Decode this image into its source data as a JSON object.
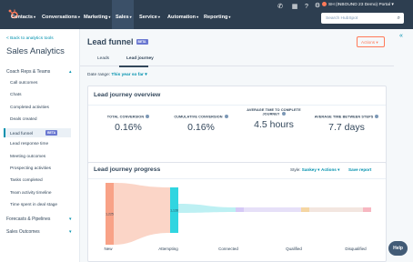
{
  "topnav": {
    "items": [
      {
        "label": "Contacts"
      },
      {
        "label": "Conversations"
      },
      {
        "label": "Marketing"
      },
      {
        "label": "Sales"
      },
      {
        "label": "Service"
      },
      {
        "label": "Automation"
      },
      {
        "label": "Reporting"
      }
    ],
    "account": "SH (INBOUND 23 Demo) Portal",
    "search_placeholder": "Search HubSpot",
    "icons": [
      "phone-icon",
      "marketplace-icon",
      "help-icon",
      "settings-icon",
      "bell-icon"
    ]
  },
  "sidebar": {
    "back_link": "< Back to analytics tools",
    "title": "Sales Analytics",
    "sections": [
      {
        "label": "Coach Reps & Teams",
        "expanded": true
      },
      {
        "label": "Forecasts & Pipelines",
        "expanded": false
      },
      {
        "label": "Sales Outcomes",
        "expanded": false
      }
    ],
    "items": [
      {
        "label": "Call outcomes"
      },
      {
        "label": "Chats"
      },
      {
        "label": "Completed activities"
      },
      {
        "label": "Deals created"
      },
      {
        "label": "Lead funnel",
        "active": true,
        "badge": "BETA"
      },
      {
        "label": "Lead response time"
      },
      {
        "label": "Meeting outcomes"
      },
      {
        "label": "Prospecting activities"
      },
      {
        "label": "Tasks completed"
      },
      {
        "label": "Team activity timeline"
      },
      {
        "label": "Time spent in deal stage"
      }
    ]
  },
  "page": {
    "title": "Lead funnel",
    "badge": "BETA",
    "actions_label": "Actions ▾",
    "tabs": [
      {
        "label": "Leads",
        "selected": false
      },
      {
        "label": "Lead journey",
        "selected": true
      }
    ],
    "date_range_label": "Date range:",
    "date_range_value": "This year so far ▾"
  },
  "overview": {
    "title": "Lead journey overview",
    "stats": [
      {
        "label": "TOTAL CONVERSION",
        "value": "0.16%"
      },
      {
        "label": "CUMULATIVE CONVERSION",
        "value": "0.16%"
      },
      {
        "label": "AVERAGE TIME TO COMPLETE JOURNEY",
        "value": "4.5 hours"
      },
      {
        "label": "AVERAGE TIME BETWEEN STEPS",
        "value": "7.7 days"
      }
    ]
  },
  "progress": {
    "title": "Lead journey progress",
    "style_label": "Style:",
    "style_value": "Sankey ▾",
    "actions_label": "Actions ▾",
    "save_label": "Save report"
  },
  "chart_data": {
    "type": "sankey",
    "stages": [
      "New",
      "Attempting",
      "Connected",
      "Qualified",
      "Disqualified"
    ],
    "stage_labels": [
      "1,225",
      "1,128",
      "",
      "",
      ""
    ],
    "colors": [
      "#f8a287",
      "#30d5e0",
      "#d5c9f6",
      "#f5d6a3",
      "#f7b7c1"
    ]
  },
  "help_label": "Help"
}
